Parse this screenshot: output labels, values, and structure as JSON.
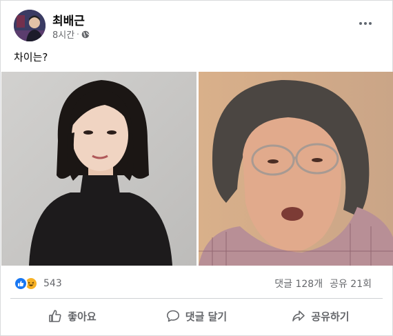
{
  "post": {
    "author": "최배근",
    "time": "8시간",
    "privacy_icon": "globe-icon",
    "text": "차이는?",
    "images": [
      {
        "description_icon": "photo-left"
      },
      {
        "description_icon": "photo-right"
      }
    ],
    "reactions": {
      "icons": [
        "like-reaction-icon",
        "haha-reaction-icon"
      ],
      "count": "543"
    },
    "comments_count": "댓글 128개",
    "shares_count": "공유 21회"
  },
  "actions": {
    "like": "좋아요",
    "comment": "댓글 달기",
    "share": "공유하기"
  },
  "colors": {
    "accent": "#1877f2",
    "muted": "#65676b",
    "haha": "#f7b125"
  }
}
